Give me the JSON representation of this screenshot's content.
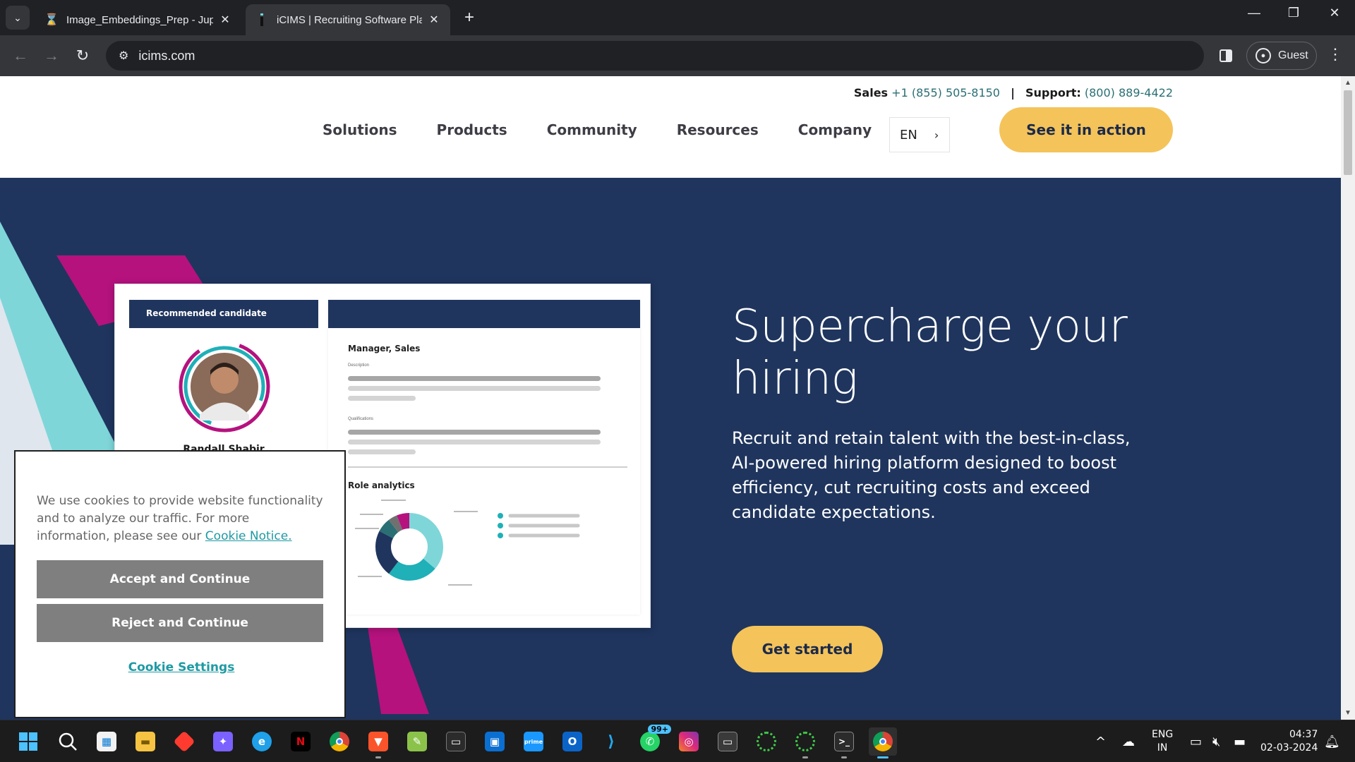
{
  "browser": {
    "tabs": [
      {
        "title": "Image_Embeddings_Prep - Jupy",
        "favicon": "hourglass-icon",
        "active": false
      },
      {
        "title": "iCIMS | Recruiting Software Plat",
        "favicon": "icims-icon",
        "active": true
      }
    ],
    "url": "icims.com",
    "profile_label": "Guest"
  },
  "site": {
    "contact": {
      "sales_label": "Sales",
      "sales_phone": "+1 (855) 505-8150",
      "separator": "|",
      "support_label": "Support:",
      "support_phone": "(800) 889-4422"
    },
    "nav": [
      "Solutions",
      "Products",
      "Community",
      "Resources",
      "Company"
    ],
    "language": "EN",
    "cta_top": "See it in action",
    "hero": {
      "title": "Supercharge your hiring",
      "subtitle": "Recruit and retain talent with the best-in-class, AI-powered hiring platform designed to boost efficiency, cut recruiting costs and exceed candidate expectations.",
      "cta": "Get started"
    },
    "mockup": {
      "left_header": "Recommended candidate",
      "candidate_name": "Randall Shabir",
      "job_title": "Manager, Sales",
      "description_label": "Description",
      "qualifications_label": "Qualifications",
      "analytics_title": "Role analytics"
    },
    "cookie_banner": {
      "text": "We use cookies to provide website functionality and to analyze our traffic. For more information, please see our",
      "link": "Cookie Notice.",
      "accept": "Accept and Continue",
      "reject": "Reject and Continue",
      "settings": "Cookie Settings"
    }
  },
  "colors": {
    "navy": "#1f355e",
    "yellow": "#f4c35a",
    "teal": "#1f9aa3",
    "magenta": "#b5127e",
    "cyan": "#6fd3d6"
  },
  "taskbar": {
    "icons": [
      "windows-start-icon",
      "search-icon",
      "store-icon",
      "file-explorer-icon",
      "app-icon",
      "copilot-icon",
      "edge-icon",
      "netflix-icon",
      "chrome-icon",
      "brave-icon",
      "notepad-icon",
      "terminal-icon",
      "app-icon",
      "prime-video-icon",
      "outlook-icon",
      "vscode-icon",
      "whatsapp-icon",
      "instagram-icon",
      "window-icon",
      "loader-icon",
      "loader-icon",
      "powershell-icon",
      "chrome-icon"
    ],
    "whatsapp_badge": "99+",
    "language_line1": "ENG",
    "language_line2": "IN",
    "time": "04:37",
    "date": "02-03-2024"
  }
}
